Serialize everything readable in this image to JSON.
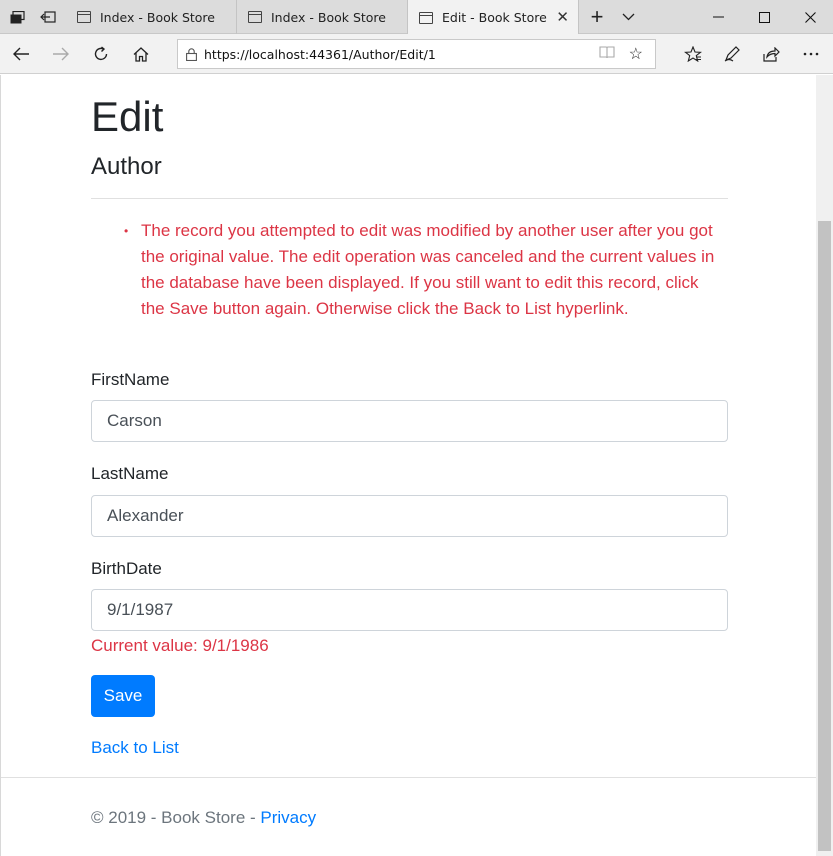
{
  "browser": {
    "tabs": [
      {
        "title": "Index - Book Store",
        "active": false
      },
      {
        "title": "Index - Book Store",
        "active": false
      },
      {
        "title": "Edit - Book Store",
        "active": true
      }
    ],
    "address_bar": {
      "url": "https://localhost:44361/Author/Edit/1",
      "url_host_part": "https://localhost",
      "url_path_part": ":44361/Author/Edit/1"
    },
    "icons": {
      "tab_actions": "tab-actions-icon",
      "set_aside": "set-aside-tabs-icon",
      "new_tab": "+",
      "tab_list": "chevron-down-icon",
      "minimize": "minimize-icon",
      "maximize": "maximize-icon",
      "close": "close-icon",
      "back": "back-arrow-icon",
      "forward": "forward-arrow-icon",
      "refresh": "refresh-icon",
      "home": "home-icon",
      "lock": "lock-icon",
      "reading_view": "reading-view-icon",
      "favorite": "star-icon",
      "favorites_hub": "favorites-hub-icon",
      "notes": "pen-icon",
      "share": "share-icon",
      "more": "more-icon"
    }
  },
  "page": {
    "title": "Edit",
    "subtitle": "Author",
    "validation_summary": "The record you attempted to edit was modified by another user after you got the original value. The edit operation was canceled and the current values in the database have been displayed. If you still want to edit this record, click the Save button again. Otherwise click the Back to List hyperlink.",
    "fields": {
      "first_name": {
        "label": "FirstName",
        "value": "Carson"
      },
      "last_name": {
        "label": "LastName",
        "value": "Alexander"
      },
      "birth_date": {
        "label": "BirthDate",
        "value": "9/1/1987",
        "error": "Current value: 9/1/1986"
      }
    },
    "save_label": "Save",
    "back_link": "Back to List",
    "footer": {
      "text": "© 2019 - Book Store - ",
      "privacy_link": "Privacy"
    }
  },
  "colors": {
    "primary": "#007bff",
    "danger": "#dc3545",
    "muted": "#6c757d",
    "text": "#212529"
  }
}
